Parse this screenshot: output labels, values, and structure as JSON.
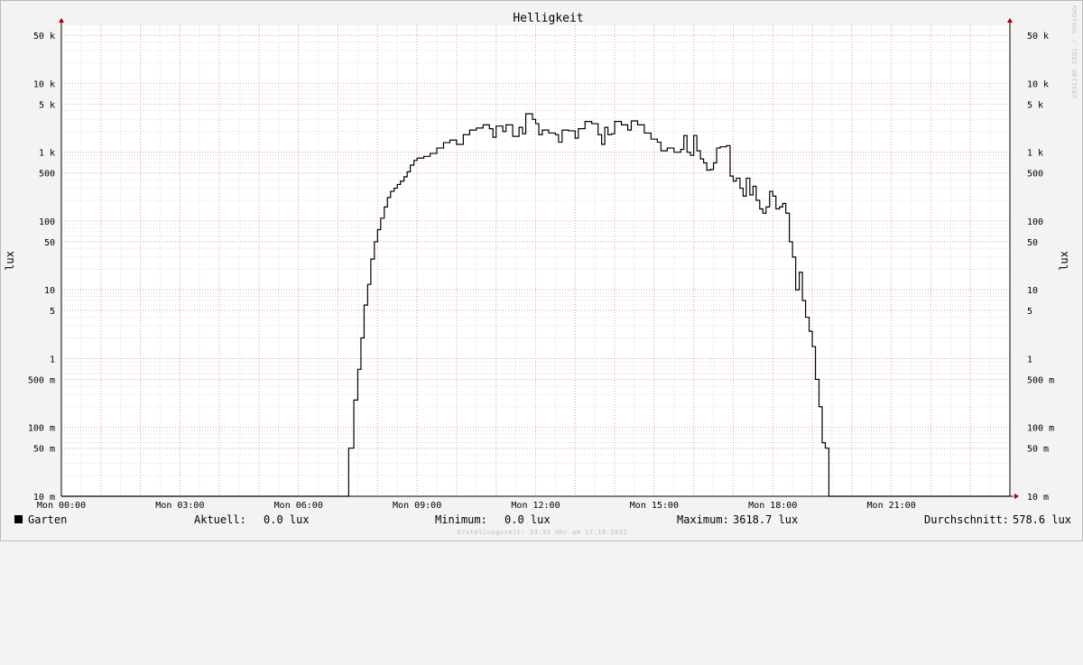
{
  "chart_data": {
    "type": "line",
    "title": "Helligkeit",
    "ylabel": "lux",
    "y_scale": "log",
    "ylim": [
      0.01,
      70000
    ],
    "xlim": [
      0,
      24
    ],
    "x_ticks": [
      {
        "v": 0,
        "label": "Mon 00:00"
      },
      {
        "v": 3,
        "label": "Mon 03:00"
      },
      {
        "v": 6,
        "label": "Mon 06:00"
      },
      {
        "v": 9,
        "label": "Mon 09:00"
      },
      {
        "v": 12,
        "label": "Mon 12:00"
      },
      {
        "v": 15,
        "label": "Mon 15:00"
      },
      {
        "v": 18,
        "label": "Mon 18:00"
      },
      {
        "v": 21,
        "label": "Mon 21:00"
      }
    ],
    "y_ticks": [
      {
        "v": 50000,
        "label": "50 k"
      },
      {
        "v": 10000,
        "label": "10 k"
      },
      {
        "v": 5000,
        "label": "5 k"
      },
      {
        "v": 1000,
        "label": "1 k"
      },
      {
        "v": 500,
        "label": "500"
      },
      {
        "v": 100,
        "label": "100"
      },
      {
        "v": 50,
        "label": "50"
      },
      {
        "v": 10,
        "label": "10"
      },
      {
        "v": 5,
        "label": "5"
      },
      {
        "v": 1,
        "label": "1"
      },
      {
        "v": 0.5,
        "label": "500 m"
      },
      {
        "v": 0.1,
        "label": "100 m"
      },
      {
        "v": 0.05,
        "label": "50 m"
      },
      {
        "v": 0.01,
        "label": "10 m"
      }
    ],
    "grid": true,
    "series": [
      {
        "name": "Garten",
        "color": "#000000",
        "points": [
          [
            0,
            0.01
          ],
          [
            7.25,
            0.01
          ],
          [
            7.27,
            0.05
          ],
          [
            7.38,
            0.05
          ],
          [
            7.4,
            0.25
          ],
          [
            7.5,
            0.7
          ],
          [
            7.58,
            2.0
          ],
          [
            7.66,
            6.0
          ],
          [
            7.75,
            12
          ],
          [
            7.83,
            28
          ],
          [
            7.92,
            50
          ],
          [
            8.0,
            75
          ],
          [
            8.08,
            110
          ],
          [
            8.17,
            160
          ],
          [
            8.25,
            220
          ],
          [
            8.33,
            270
          ],
          [
            8.42,
            300
          ],
          [
            8.5,
            340
          ],
          [
            8.58,
            380
          ],
          [
            8.67,
            440
          ],
          [
            8.75,
            520
          ],
          [
            8.83,
            650
          ],
          [
            8.92,
            760
          ],
          [
            9.0,
            820
          ],
          [
            9.17,
            870
          ],
          [
            9.33,
            960
          ],
          [
            9.5,
            1150
          ],
          [
            9.67,
            1380
          ],
          [
            9.83,
            1500
          ],
          [
            10.0,
            1300
          ],
          [
            10.17,
            1800
          ],
          [
            10.33,
            2100
          ],
          [
            10.5,
            2250
          ],
          [
            10.67,
            2500
          ],
          [
            10.83,
            2200
          ],
          [
            10.92,
            1650
          ],
          [
            11.0,
            2400
          ],
          [
            11.17,
            2000
          ],
          [
            11.25,
            2500
          ],
          [
            11.42,
            1700
          ],
          [
            11.58,
            2300
          ],
          [
            11.67,
            1850
          ],
          [
            11.75,
            3618.7
          ],
          [
            11.92,
            3000
          ],
          [
            12.0,
            2600
          ],
          [
            12.08,
            1800
          ],
          [
            12.17,
            2100
          ],
          [
            12.33,
            1900
          ],
          [
            12.5,
            1800
          ],
          [
            12.58,
            1400
          ],
          [
            12.67,
            2100
          ],
          [
            12.83,
            2050
          ],
          [
            13.0,
            1600
          ],
          [
            13.08,
            2200
          ],
          [
            13.25,
            2800
          ],
          [
            13.42,
            2600
          ],
          [
            13.58,
            1800
          ],
          [
            13.67,
            1300
          ],
          [
            13.75,
            2300
          ],
          [
            13.83,
            1800
          ],
          [
            13.92,
            1850
          ],
          [
            14.0,
            2800
          ],
          [
            14.17,
            2500
          ],
          [
            14.33,
            2100
          ],
          [
            14.42,
            2850
          ],
          [
            14.58,
            2500
          ],
          [
            14.75,
            1900
          ],
          [
            14.92,
            1550
          ],
          [
            15.08,
            1400
          ],
          [
            15.17,
            1050
          ],
          [
            15.33,
            1150
          ],
          [
            15.5,
            1000
          ],
          [
            15.67,
            1100
          ],
          [
            15.75,
            1750
          ],
          [
            15.83,
            1000
          ],
          [
            15.92,
            900
          ],
          [
            16.0,
            1750
          ],
          [
            16.08,
            1050
          ],
          [
            16.17,
            800
          ],
          [
            16.25,
            700
          ],
          [
            16.33,
            550
          ],
          [
            16.42,
            560
          ],
          [
            16.5,
            700
          ],
          [
            16.58,
            1150
          ],
          [
            16.67,
            1200
          ],
          [
            16.83,
            1250
          ],
          [
            16.92,
            450
          ],
          [
            17.0,
            380
          ],
          [
            17.08,
            420
          ],
          [
            17.17,
            300
          ],
          [
            17.25,
            230
          ],
          [
            17.33,
            420
          ],
          [
            17.42,
            240
          ],
          [
            17.5,
            320
          ],
          [
            17.58,
            200
          ],
          [
            17.67,
            150
          ],
          [
            17.75,
            130
          ],
          [
            17.83,
            160
          ],
          [
            17.92,
            270
          ],
          [
            18.0,
            230
          ],
          [
            18.08,
            150
          ],
          [
            18.17,
            160
          ],
          [
            18.25,
            180
          ],
          [
            18.33,
            130
          ],
          [
            18.42,
            50
          ],
          [
            18.5,
            30
          ],
          [
            18.58,
            10
          ],
          [
            18.67,
            18
          ],
          [
            18.75,
            7
          ],
          [
            18.83,
            4
          ],
          [
            18.92,
            2.5
          ],
          [
            19.0,
            1.5
          ],
          [
            19.08,
            0.5
          ],
          [
            19.17,
            0.2
          ],
          [
            19.25,
            0.06
          ],
          [
            19.33,
            0.05
          ],
          [
            19.42,
            0.01
          ],
          [
            24,
            0.01
          ]
        ]
      }
    ]
  },
  "legend": {
    "series_name": "Garten",
    "current_label": "Aktuell:",
    "current_value": "0.0 lux",
    "min_label": "Minimum:",
    "min_value": "0.0 lux",
    "max_label": "Maximum:",
    "max_value": "3618.7 lux",
    "avg_label": "Durchschnitt:",
    "avg_value": "578.6 lux"
  },
  "footer": "Erstellungszeit: 23:55 Uhr am 17.10.2022",
  "watermark": "RRDTOOL / TOBI OETIKER"
}
